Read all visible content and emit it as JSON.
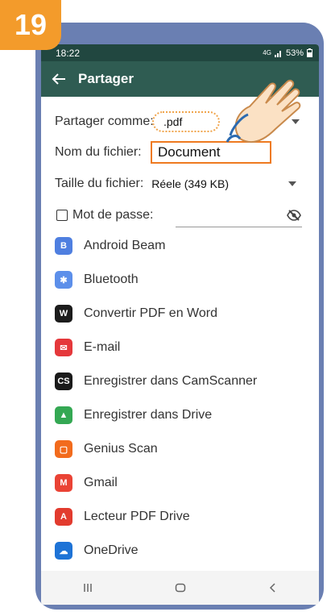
{
  "step_badge": "19",
  "status": {
    "time": "18:22",
    "network": "4G",
    "battery": "53%"
  },
  "toolbar": {
    "title": "Partager"
  },
  "share_as": {
    "label": "Partager comme:",
    "value": ".pdf"
  },
  "file_name": {
    "label": "Nom du fichier:",
    "value": "Document"
  },
  "file_size": {
    "label": "Taille du fichier:",
    "value": "Réele (349 KB)"
  },
  "password": {
    "label": "Mot de passe:"
  },
  "apps": [
    {
      "label": "Android Beam",
      "icon": "android-beam-icon",
      "color": "#4f7fe0"
    },
    {
      "label": "Bluetooth",
      "icon": "bluetooth-icon",
      "color": "#5c8fea"
    },
    {
      "label": "Convertir PDF en Word",
      "icon": "word-convert-icon",
      "color": "#1c1c1c"
    },
    {
      "label": "E-mail",
      "icon": "email-icon",
      "color": "#e5383b"
    },
    {
      "label": "Enregistrer dans CamScanner",
      "icon": "camscanner-icon",
      "color": "#1a1a1a"
    },
    {
      "label": "Enregistrer dans Drive",
      "icon": "google-drive-icon",
      "color": "#34a853"
    },
    {
      "label": "Genius Scan",
      "icon": "genius-scan-icon",
      "color": "#f26b1d"
    },
    {
      "label": "Gmail",
      "icon": "gmail-icon",
      "color": "#ea4335"
    },
    {
      "label": "Lecteur PDF Drive",
      "icon": "pdf-reader-icon",
      "color": "#e23b2e"
    },
    {
      "label": "OneDrive",
      "icon": "onedrive-icon",
      "color": "#1e73d6"
    }
  ]
}
